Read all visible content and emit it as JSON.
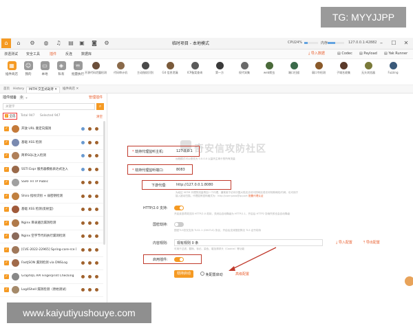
{
  "overlay": {
    "top_watermark": "TG: MYYJJPP",
    "bottom_watermark": "www.kaiyutiyushouye.com"
  },
  "titlebar": {
    "title": "临时项目 - 本地模式",
    "cpu_label": "CPU",
    "cpu_percent": "24%",
    "mem_label": "内存",
    "mem_fraction": 0.45,
    "cpu_fraction": 0.24,
    "port": "127.0.0.1:42882",
    "logo_char": "⌂"
  },
  "menu": {
    "items": [
      "渗透测试",
      "安全工具",
      "插件",
      "反连",
      "数据库"
    ],
    "active_index": 2,
    "right": {
      "import_label": "导入数据",
      "codec_label": "Codec",
      "payload_label": "Payload",
      "yak_label": "Yak Runner"
    }
  },
  "toolbar": {
    "tools": [
      {
        "label": "插件商店",
        "icon": "store-icon",
        "color": "#f59a23"
      },
      {
        "label": "我的",
        "icon": "user-icon",
        "color": "#e0e0e0"
      },
      {
        "label": "本地",
        "icon": "local-icon",
        "color": "#e0e0e0"
      },
      {
        "label": "私有",
        "icon": "private-icon",
        "color": "#e0e0e0"
      },
      {
        "label": "批量执行",
        "icon": "batch-icon",
        "color": "#e0e0e0"
      }
    ],
    "favorites_label": "常用插件",
    "plugins": [
      "开源代码泄露检测",
      "代码审计机",
      "主动指纹识别",
      "Git 信息泄漏",
      "ICP备案查询",
      "第一方",
      "权代采集",
      "web爬虫",
      "端口扫描",
      "弱口令检测",
      "子域名收集",
      "无头浏览器",
      "Fuzzing"
    ]
  },
  "tabs": [
    "首页",
    "History",
    "MITM 交互式劫持",
    "插件商店"
  ],
  "tabs_active_index": 2,
  "sidebar": {
    "header": "插件储备",
    "count": "0",
    "edit_label": "管理插件",
    "search_placeholder": "关键字",
    "filters": {
      "all": "全选",
      "total": "Total 947",
      "selected": "Selected 947"
    },
    "clear_label": "清空",
    "items": [
      "开放 URL 重定向漏洞",
      "基础 XSS 检测",
      "简单SQL注入检测",
      "SSTI Expr 服务器模板表达式注入",
      "SSRF HTTP Public",
      "Shiro 指纹识别 + 弱密钥检测",
      "基础 XSS 检测(反射型)",
      "Nginx 目录遍历漏洞检测",
      "Nginx 空字节代码执行漏洞检测",
      "[CVE-2022-22965] Spring-core-rce 检测",
      "FastJSON 漏洞检测 via DNSLog",
      "GraphQL API Fingerprint Checking",
      "Log4Shell 漏洞检测（原始测试）"
    ]
  },
  "form": {
    "proxy_host_label": "劫持代理监听主机:",
    "proxy_host_value": "127.0.0.1",
    "proxy_host_hint": "远程模式可以修改为 0.0.0.0 以监听主网卡的所有流量",
    "proxy_port_label": "劫持代理监听端口:",
    "proxy_port_value": "8083",
    "downstream_label": "下游代理:",
    "downstream_value": "http://127.0.0.1:8080",
    "downstream_hint": "为经过 MITM 代理的流量再加一个代理，通常用于访问中国大陆无法访问的网站或访问特殊网络/内网，也可用于接入被动扫描，代理如有密码格式为：http://user:pass@ip:port",
    "downstream_link": "配置代理认证",
    "http2_label": "HTTP/2.0 支持:",
    "http2_on": true,
    "http2_hint": "开启该选项将支持 HTTP/2.0 劫持，关闭后自动降级为 HTTP/1.1，开启后 HTTP2 协商失败也会自动降级",
    "gm_label": "国密劫持:",
    "gm_on": false,
    "gm_hint": "国密TLS仅仅支持 TLS1.1 (GM-TLS) 协议，开启后支持国密算法 TLS 证书劫持",
    "rules_label": "内容规则:",
    "rules_value": "现有规则 0 条",
    "rules_hint": "可用于过滤、替换、标记、染色、增加请求头（Cookie）等功能",
    "import_config": "导入配置",
    "export_config": "导出配置",
    "enable_plugin_label": "启用插件:",
    "enable_plugin_on": true,
    "start_label": "劫持启动",
    "passive_label": "免配置启动",
    "advanced_label": "高级配置",
    "middle_watermark": "奇安信攻防社区"
  }
}
